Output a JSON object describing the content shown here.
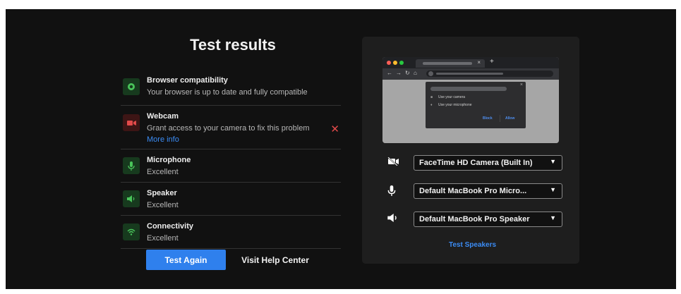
{
  "title": "Test results",
  "results": [
    {
      "name": "Browser compatibility",
      "desc": "Your browser is up to date and fully compatible",
      "status": "ok",
      "icon": "chrome-icon"
    },
    {
      "name": "Webcam",
      "desc": "Grant access to your camera to fix this problem",
      "more": "More info",
      "status": "error",
      "icon": "webcam-icon"
    },
    {
      "name": "Microphone",
      "desc": "Excellent",
      "status": "ok",
      "icon": "microphone-icon"
    },
    {
      "name": "Speaker",
      "desc": "Excellent",
      "status": "ok",
      "icon": "speaker-icon"
    },
    {
      "name": "Connectivity",
      "desc": "Excellent",
      "status": "ok",
      "icon": "wifi-icon"
    }
  ],
  "actions": {
    "test_again": "Test Again",
    "help_center": "Visit Help Center"
  },
  "preview": {
    "popup_lines": [
      "Use your camera",
      "Use your microphone"
    ],
    "block_label": "Block",
    "allow_label": "Allow"
  },
  "devices": {
    "camera": "FaceTime HD Camera (Built In)",
    "microphone": "Default MacBook Pro Micro...",
    "speaker": "Default MacBook Pro Speaker",
    "test_speakers": "Test Speakers"
  },
  "colors": {
    "accent": "#2f80ed",
    "ok": "#49c45a",
    "error": "#e24a4a",
    "link": "#3b8cf5"
  }
}
